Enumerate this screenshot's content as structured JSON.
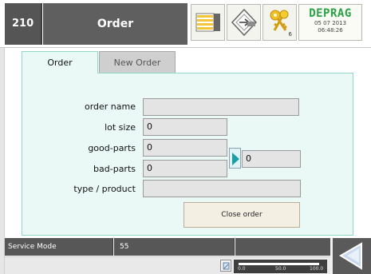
{
  "header": {
    "screen_number": "210",
    "title": "Order",
    "key_count": "6",
    "brand": "DEPRAG",
    "date": "05 07 2013",
    "time": "06:48:26"
  },
  "tabs": [
    {
      "label": "Order",
      "active": true
    },
    {
      "label": "New Order",
      "active": false
    }
  ],
  "form": {
    "order_name": {
      "label": "order name",
      "value": ""
    },
    "lot_size": {
      "label": "lot size",
      "value": "0"
    },
    "good_parts": {
      "label": "good-parts",
      "value": "0"
    },
    "bad_parts": {
      "label": "bad-parts",
      "value": "0"
    },
    "type_product": {
      "label": "type / product",
      "value": ""
    },
    "parts_counter": {
      "value": "0"
    },
    "close_button": "Close order"
  },
  "footer": {
    "mode": "Service Mode",
    "number": "55",
    "gauge": {
      "min": "0.0",
      "mid": "50.0",
      "max": "100.0",
      "value": 1.0
    }
  },
  "colors": {
    "panel_bg": "#eaf9f5",
    "panel_border": "#8fd8c6",
    "header_dark": "#5f5f5f",
    "brand_green": "#2aa345",
    "arrow_teal": "#1a9fa6"
  },
  "icons": {
    "list": "list-icon",
    "nav": "navigate-icon",
    "keys": "keys-icon",
    "arrow": "play-arrow-icon",
    "gauge": "gauge-icon",
    "back": "back-arrow-icon"
  }
}
